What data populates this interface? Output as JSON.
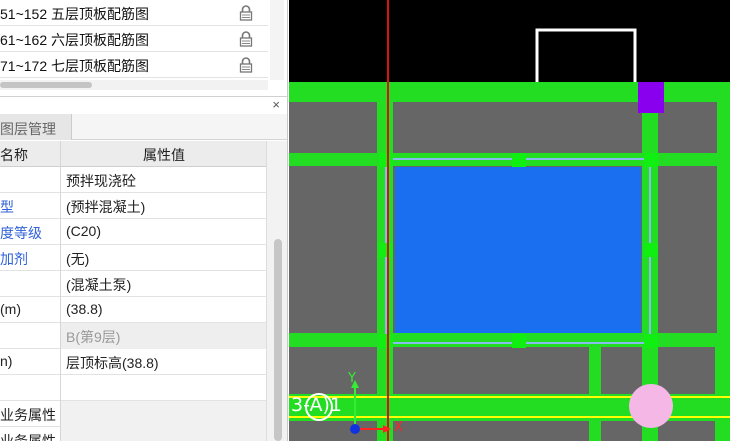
{
  "drawing_list": {
    "items": [
      {
        "label": "51~152 五层顶板配筋图",
        "lock_icon": "lock-icon"
      },
      {
        "label": "61~162 六层顶板配筋图",
        "lock_icon": "lock-icon"
      },
      {
        "label": "71~172 七层顶板配筋图",
        "lock_icon": "lock-icon"
      }
    ]
  },
  "property_panel": {
    "close_label": "×",
    "tabs": [
      {
        "label": "图层管理"
      }
    ],
    "columns": {
      "name": "名称",
      "value": "属性值"
    },
    "rows": [
      {
        "name": "",
        "value": "预拌现浇砼",
        "link": false
      },
      {
        "name": "型",
        "value": "(预拌混凝土)",
        "link": true
      },
      {
        "name": "度等级",
        "value": "(C20)",
        "link": true
      },
      {
        "name": "加剂",
        "value": "(无)",
        "link": true
      },
      {
        "name": "",
        "value": "(混凝土泵)",
        "link": false
      },
      {
        "name": "(m)",
        "value": "(38.8)",
        "link": false
      },
      {
        "name": "",
        "value": "B(第9层)",
        "link": false,
        "disabled": true
      },
      {
        "name": "n)",
        "value": "层顶标高(38.8)",
        "link": false
      },
      {
        "name": "",
        "value": "",
        "link": false
      },
      {
        "name": "业务属性",
        "value": "",
        "link": false,
        "group": true
      },
      {
        "name": "业务属性",
        "value": "",
        "link": false,
        "group": true
      }
    ]
  },
  "canvas": {
    "axis_label": "3-A)1",
    "y_axis_label": "Y",
    "x_axis_label": "X",
    "colors": {
      "background": "#000000",
      "slab": "#666666",
      "beam": "#22dd22",
      "selected_slab": "#1a6ef0",
      "column": "#8800ee",
      "marker": "#f5b8e6",
      "gridline_red": "#dd1111",
      "gridline_yellow": "#ffff00"
    }
  }
}
